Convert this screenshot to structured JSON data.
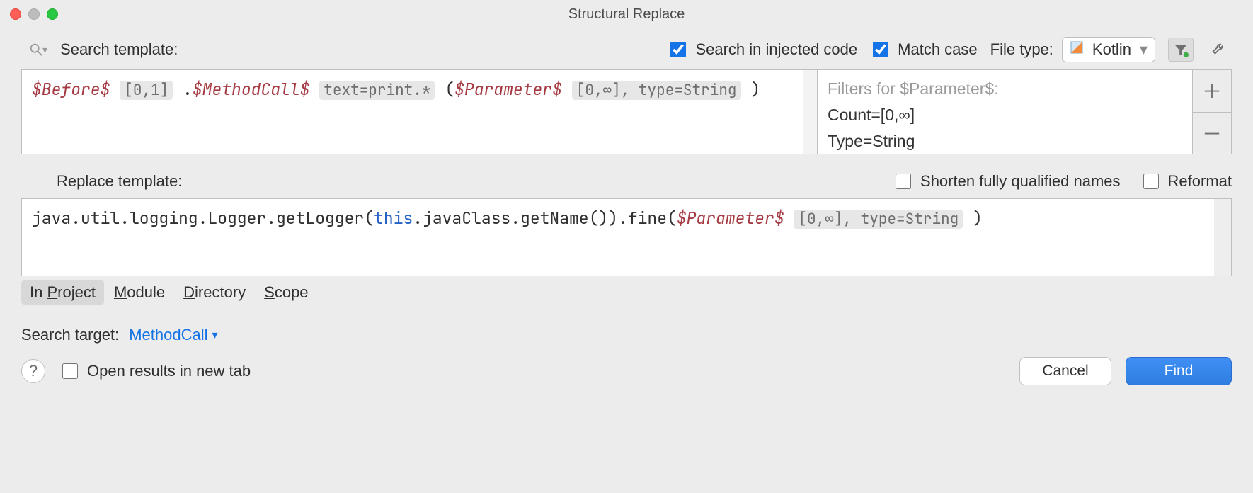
{
  "window": {
    "title": "Structural Replace"
  },
  "options": {
    "search_template_label": "Search template:",
    "search_injected_label": "Search in injected code",
    "search_injected_checked": true,
    "match_case_label": "Match case",
    "match_case_checked": true,
    "file_type_label": "File type:",
    "file_type_value": "Kotlin"
  },
  "search_template": {
    "tokens": {
      "before": "$Before$",
      "before_pill": "[0,1]",
      "dot": ".",
      "methodcall": "$MethodCall$",
      "method_pill": "text=print.*",
      "open": "(",
      "parameter": "$Parameter$",
      "param_pill": "[0,∞], type=String",
      "close": ")"
    }
  },
  "filters_panel": {
    "title": "Filters for $Parameter$:",
    "lines": [
      "Count=[0,∞]",
      "Type=String"
    ]
  },
  "replace": {
    "label": "Replace template:",
    "shorten_label": "Shorten fully qualified names",
    "shorten_checked": false,
    "reformat_label": "Reformat",
    "reformat_checked": false,
    "tokens": {
      "prefix": "java.util.logging.Logger.getLogger(",
      "this": "this",
      "mid": ".javaClass.getName()).fine(",
      "parameter": "$Parameter$",
      "param_pill": "[0,∞], type=String",
      "close": ")"
    }
  },
  "scope": {
    "tabs": [
      {
        "label": "In Project",
        "underline_index": 3,
        "active": true
      },
      {
        "label": "Module",
        "underline_index": 0,
        "active": false
      },
      {
        "label": "Directory",
        "underline_index": 0,
        "active": false
      },
      {
        "label": "Scope",
        "underline_index": 0,
        "active": false
      }
    ]
  },
  "search_target": {
    "label": "Search target:",
    "value": "MethodCall"
  },
  "bottom": {
    "open_results_label": "Open results in new tab",
    "open_results_checked": false,
    "cancel": "Cancel",
    "find": "Find"
  }
}
